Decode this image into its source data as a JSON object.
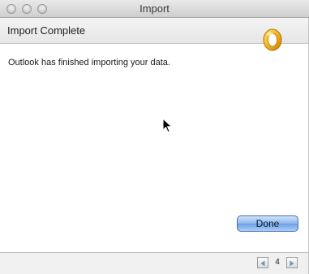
{
  "window": {
    "title": "Import"
  },
  "header": {
    "title": "Import Complete",
    "logo_icon": "outlook-logo-icon"
  },
  "main": {
    "message": "Outlook has finished importing your data."
  },
  "actions": {
    "done_label": "Done"
  },
  "footer": {
    "page_number": "4",
    "prev_icon": "triangle-left-icon",
    "next_icon": "triangle-right-icon"
  },
  "colors": {
    "accent": "#6f9fe2",
    "logo_gold": "#e9a318"
  }
}
